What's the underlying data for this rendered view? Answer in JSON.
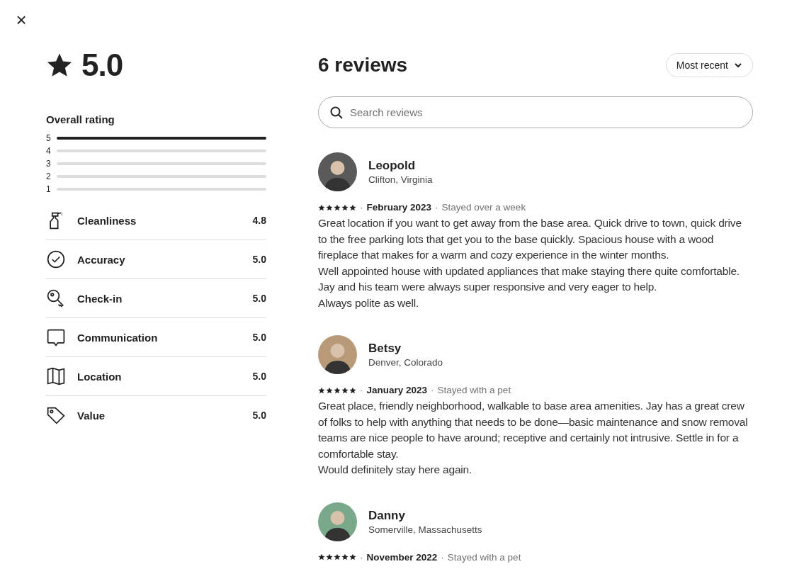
{
  "close_button": "×",
  "overall": {
    "score": "5.0",
    "title": "Overall rating",
    "bars": [
      {
        "label": "5",
        "level": 1
      },
      {
        "label": "4",
        "level": 0
      },
      {
        "label": "3",
        "level": 0
      },
      {
        "label": "2",
        "level": 0
      },
      {
        "label": "1",
        "level": 0
      }
    ]
  },
  "categories": [
    {
      "kind": "spray",
      "label": "Cleanliness",
      "score": "4.8"
    },
    {
      "kind": "check",
      "label": "Accuracy",
      "score": "5.0"
    },
    {
      "kind": "key",
      "label": "Check-in",
      "score": "5.0"
    },
    {
      "kind": "chat",
      "label": "Communication",
      "score": "5.0"
    },
    {
      "kind": "map",
      "label": "Location",
      "score": "5.0"
    },
    {
      "kind": "tag",
      "label": "Value",
      "score": "5.0"
    }
  ],
  "reviews_title": "6 reviews",
  "sort": {
    "label": "Most recent"
  },
  "search": {
    "placeholder": "Search reviews"
  },
  "reviews": [
    {
      "name": "Leopold",
      "location": "Clifton, Virginia",
      "stars": 5,
      "separators": [
        "·",
        "·"
      ],
      "date": "February 2023",
      "stay": "Stayed over a week",
      "text": "Great location if you want to get away from the base area. Quick drive to town, quick drive to the free parking lots that get you to the base quickly. Spacious house with a wood fireplace that makes for a warm and cozy experience in the winter months.\nWell appointed house with updated appliances that make staying there quite comfortable. Jay and his team were always super responsive and very eager to help.\nAlways polite as well."
    },
    {
      "name": "Betsy",
      "location": "Denver, Colorado",
      "stars": 5,
      "separators": [
        "·",
        "·"
      ],
      "date": "January 2023",
      "stay": "Stayed with a pet",
      "text": "Great place, friendly neighborhood, walkable to base area amenities. Jay has a great crew of folks to help with anything that needs to be done—basic maintenance and snow removal teams are nice people to have around; receptive and certainly not intrusive. Settle in for a comfortable stay.\nWould definitely stay here again."
    },
    {
      "name": "Danny",
      "location": "Somerville, Massachusetts",
      "stars": 5,
      "separators": [
        "·",
        "·"
      ],
      "date": "November 2022",
      "stay": "Stayed with a pet"
    }
  ]
}
